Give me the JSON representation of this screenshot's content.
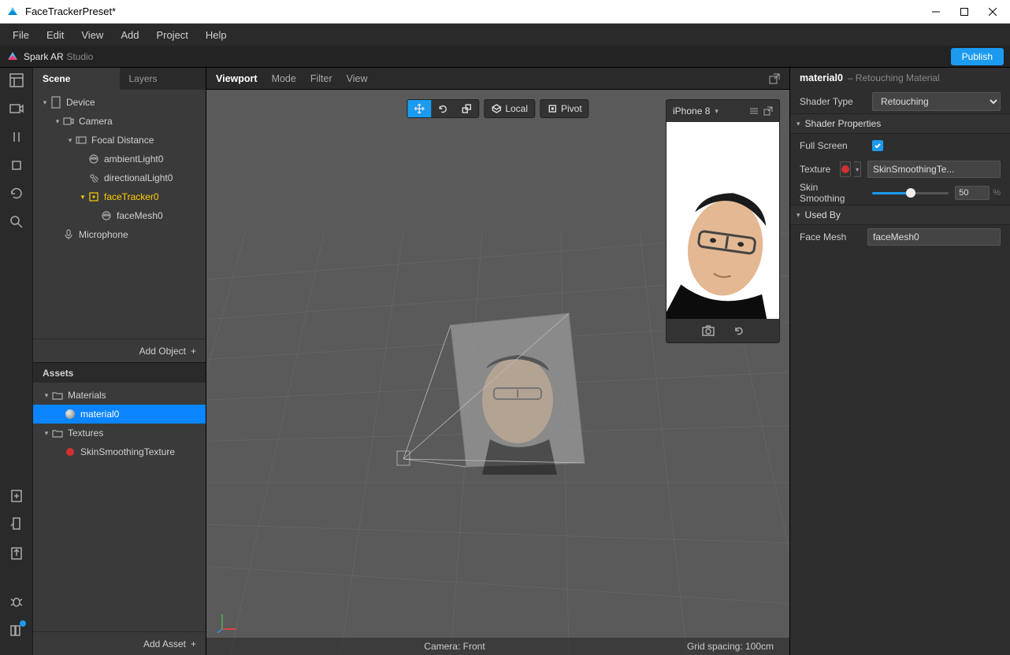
{
  "window": {
    "title": "FaceTrackerPreset*"
  },
  "menu": [
    "File",
    "Edit",
    "View",
    "Add",
    "Project",
    "Help"
  ],
  "brand": {
    "name": "Spark AR",
    "suffix": "Studio",
    "publish": "Publish"
  },
  "leftTabs": {
    "scene": "Scene",
    "layers": "Layers"
  },
  "scene": {
    "device": "Device",
    "camera": "Camera",
    "focal": "Focal Distance",
    "ambient": "ambientLight0",
    "directional": "directionalLight0",
    "facetracker": "faceTracker0",
    "facemesh": "faceMesh0",
    "microphone": "Microphone",
    "addObject": "Add Object"
  },
  "assets": {
    "header": "Assets",
    "materialsFolder": "Materials",
    "material0": "material0",
    "texturesFolder": "Textures",
    "skinTex": "SkinSmoothingTexture",
    "addAsset": "Add Asset"
  },
  "viewport": {
    "tabs": {
      "viewport": "Viewport",
      "mode": "Mode",
      "filter": "Filter",
      "view": "View"
    },
    "local": "Local",
    "pivot": "Pivot",
    "device": "iPhone 8",
    "camera": "Camera: Front",
    "grid": "Grid spacing: 100cm"
  },
  "inspector": {
    "name": "material0",
    "subtitle": "– Retouching Material",
    "shaderTypeLabel": "Shader Type",
    "shaderType": "Retouching",
    "shaderProps": "Shader Properties",
    "fullScreen": "Full Screen",
    "texture": "Texture",
    "textureName": "SkinSmoothingTe...",
    "skinSmoothing": "Skin Smoothing",
    "skinValue": "50",
    "percent": "%",
    "usedBy": "Used By",
    "faceMeshLabel": "Face Mesh",
    "faceMeshVal": "faceMesh0"
  }
}
